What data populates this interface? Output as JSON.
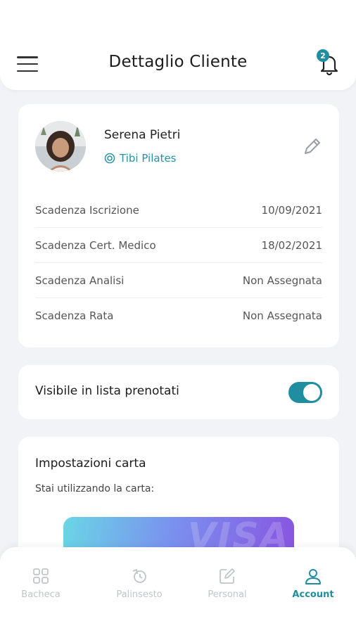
{
  "header": {
    "title": "Dettaglio Cliente",
    "notification_count": "2"
  },
  "client": {
    "name": "Serena Pietri",
    "studio": "Tibi Pilates",
    "rows": [
      {
        "label": "Scadenza Iscrizione",
        "value": "10/09/2021"
      },
      {
        "label": "Scadenza Cert. Medico",
        "value": "18/02/2021"
      },
      {
        "label": "Scadenza Analisi",
        "value": "Non Assegnata"
      },
      {
        "label": "Scadenza Rata",
        "value": "Non Assegnata"
      }
    ]
  },
  "visibility": {
    "label": "Visibile in lista prenotati",
    "enabled": true
  },
  "card_settings": {
    "title": "Impostazioni carta",
    "subtitle": "Stai utilizzando la carta:",
    "card_brand": "VISA"
  },
  "nav": {
    "items": [
      {
        "label": "Bacheca",
        "icon": "grid-icon",
        "active": false
      },
      {
        "label": "Palinsesto",
        "icon": "schedule-icon",
        "active": false
      },
      {
        "label": "Personal",
        "icon": "edit-square-icon",
        "active": false
      },
      {
        "label": "Account",
        "icon": "user-icon",
        "active": true
      }
    ]
  },
  "colors": {
    "accent": "#1f8ea0",
    "background": "#f2f3f6",
    "inactive_nav": "#c2c4c8"
  }
}
